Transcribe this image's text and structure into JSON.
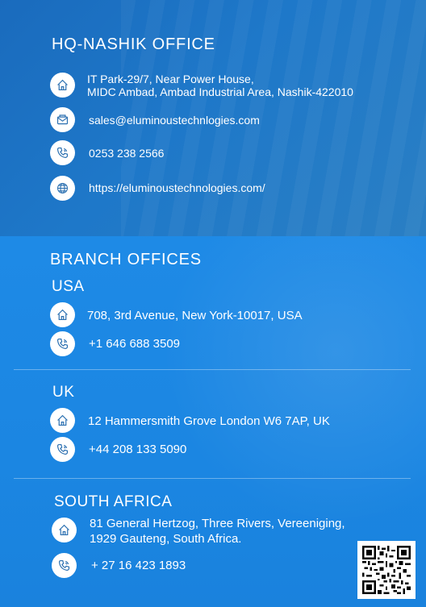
{
  "hq": {
    "title": "HQ-NASHIK OFFICE",
    "address_line1": "IT Park-29/7, Near Power House,",
    "address_line2": "MIDC Ambad, Ambad Industrial Area, Nashik-422010",
    "email": "sales@eluminoustechnlogies.com",
    "phone": "0253 238 2566",
    "website": "https://eluminoustechnologies.com/"
  },
  "branch": {
    "title": "BRANCH OFFICES",
    "usa": {
      "name": "USA",
      "address": "708, 3rd Avenue, New York-10017, USA",
      "phone": "+1 646 688 3509"
    },
    "uk": {
      "name": "UK",
      "address": "12 Hammersmith Grove London W6 7AP, UK",
      "phone": "+44 208 133 5090"
    },
    "sa": {
      "name": "SOUTH AFRICA",
      "address_line1": "81 General Hertzog, Three Rivers, Vereeniging,",
      "address_line2": "1929 Gauteng, South Africa.",
      "phone": "+ 27 16 423 1893"
    }
  },
  "icons": {
    "home": "home-icon",
    "mail": "mail-icon",
    "phone": "phone-icon",
    "globe": "globe-icon",
    "qr": "qr-code"
  },
  "colors": {
    "hq_bg": "#1a6bbd",
    "branch_bg": "#1e8ae6",
    "icon_fg": "#2a6fb0",
    "text": "#ffffff"
  }
}
